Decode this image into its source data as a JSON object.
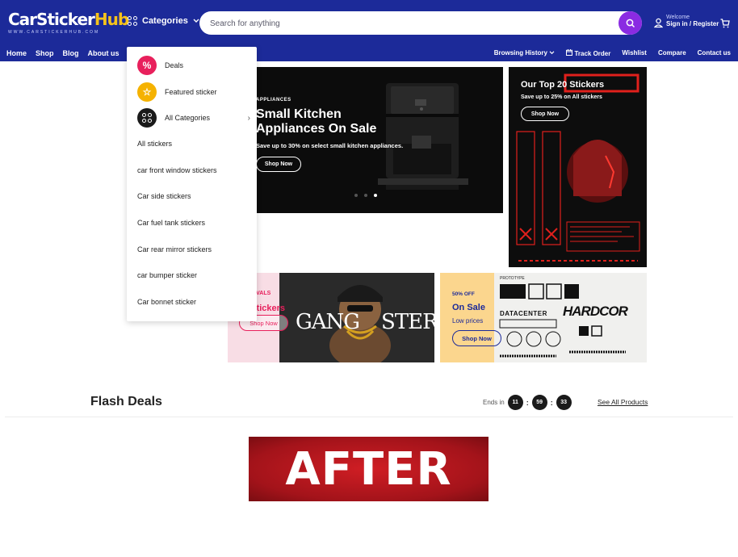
{
  "header": {
    "logo_part1": "CarSticker",
    "logo_part2": "Hub",
    "logo_tagline": "WWW.CARSTICKERHUB.COM",
    "categories_label": "Categories",
    "search_placeholder": "Search for anything",
    "welcome_label": "Welcome",
    "signin_label": "Sign in / Register"
  },
  "nav_left": [
    "Home",
    "Shop",
    "Blog",
    "About us"
  ],
  "nav_right": {
    "browsing_history": "Browsing History",
    "track_order": "Track Order",
    "wishlist": "Wishlist",
    "compare": "Compare",
    "contact": "Contact us"
  },
  "dropdown": {
    "deals": "Deals",
    "featured": "Featured sticker",
    "all_categories": "All Categories",
    "items": [
      "All stickers",
      "car front window stickers",
      "Car side stickers",
      "Car fuel tank stickers",
      "Car rear mirror stickers",
      "car bumper sticker",
      "Car bonnet sticker"
    ]
  },
  "hero": {
    "small": "APPLIANCES",
    "title": "Small Kitchen Appliances On Sale",
    "subtitle": "Save up to 30% on select small kitchen appliances.",
    "button": "Shop Now"
  },
  "top20": {
    "title": "Our Top 20 Stickers",
    "subtitle": "Save up to 25% on All stickers",
    "button": "Shop Now"
  },
  "gang_banner": {
    "small": "NEW ARRIVALS",
    "title": "new stickers",
    "button": "Shop Now",
    "art_left": "GANG",
    "art_right": "STER"
  },
  "proto_banner": {
    "small": "50% OFF",
    "title": "On Sale",
    "subtitle": "Low prices",
    "button": "Shop Now",
    "art_header": "PROTOTYPE",
    "art_center": "DATACENTER",
    "art_brand": "HARDCOR"
  },
  "flash_deals": {
    "title": "Flash Deals",
    "ends_in": "Ends in",
    "hours": "11",
    "minutes": "59",
    "seconds": "33",
    "see_all": "See All Products"
  },
  "after_banner": {
    "text": "AFTER"
  },
  "colors": {
    "header_bg": "#1c2a99",
    "logo_accent": "#f5c21b",
    "search_button": "#8a2be2",
    "deals_icon": "#e8205c",
    "featured_icon": "#f5b200",
    "after_red": "#c8161d"
  }
}
